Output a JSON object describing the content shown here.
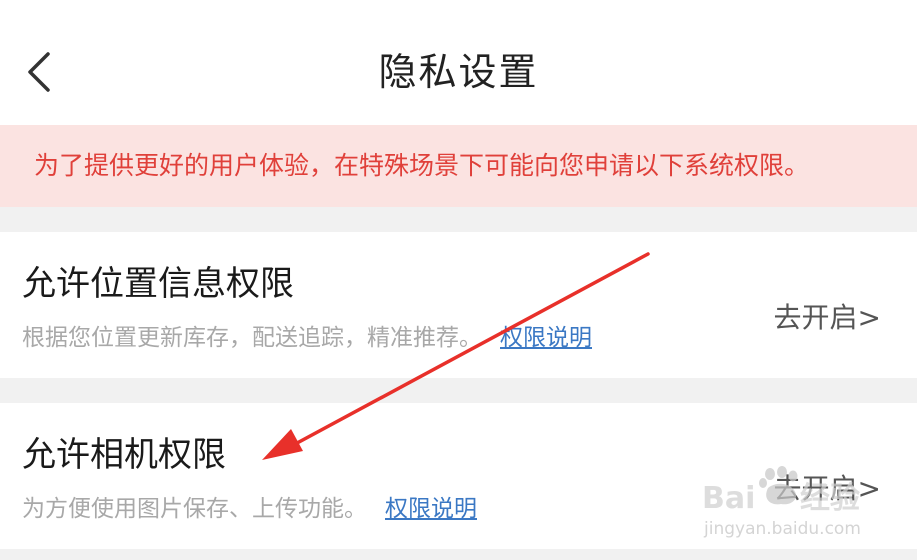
{
  "header": {
    "title": "隐私设置",
    "back_icon": "chevron-left-icon"
  },
  "notice": {
    "text": "为了提供更好的用户体验，在特殊场景下可能向您申请以下系统权限。",
    "color": "#e0403a",
    "background": "#fbe3e1"
  },
  "permissions": [
    {
      "title": "允许位置信息权限",
      "description": "根据您位置更新库存，配送追踪，精准推荐。",
      "link_label": "权限说明",
      "action_label": "去开启>"
    },
    {
      "title": "允许相机权限",
      "description": "为方便使用图片保存、上传功能。",
      "link_label": "权限说明",
      "action_label": "去开启>"
    }
  ],
  "annotation": {
    "arrow_color": "#e8302a"
  },
  "colors": {
    "link": "#3b78c4",
    "background": "#f1f1f1"
  }
}
